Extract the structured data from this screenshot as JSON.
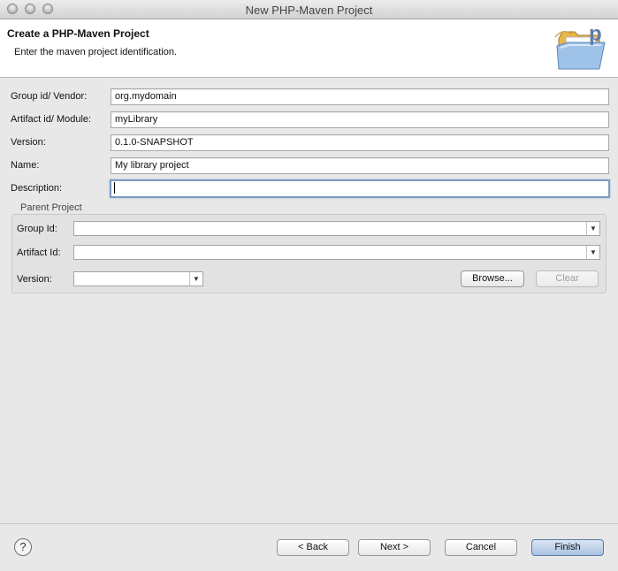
{
  "window": {
    "title": "New PHP-Maven Project"
  },
  "header": {
    "title": "Create a PHP-Maven Project",
    "description": "Enter the maven project identification.",
    "image_icon": "php-maven-folder-icon"
  },
  "form": {
    "group_id_label": "Group id/ Vendor:",
    "group_id_value": "org.mydomain",
    "artifact_id_label": "Artifact id/ Module:",
    "artifact_id_value": "myLibrary",
    "version_label": "Version:",
    "version_value": "0.1.0-SNAPSHOT",
    "name_label": "Name:",
    "name_value": "My library project",
    "description_label": "Description:",
    "description_value": ""
  },
  "parent": {
    "group_title": "Parent Project",
    "group_id_label": "Group Id:",
    "artifact_id_label": "Artifact Id:",
    "version_label": "Version:",
    "browse_label": "Browse...",
    "clear_label": "Clear"
  },
  "footer": {
    "help_glyph": "?",
    "back_label": "< Back",
    "next_label": "Next >",
    "cancel_label": "Cancel",
    "finish_label": "Finish"
  },
  "colors": {
    "focus_ring": "#7d9cc2",
    "default_button": "#a9c2e1"
  }
}
